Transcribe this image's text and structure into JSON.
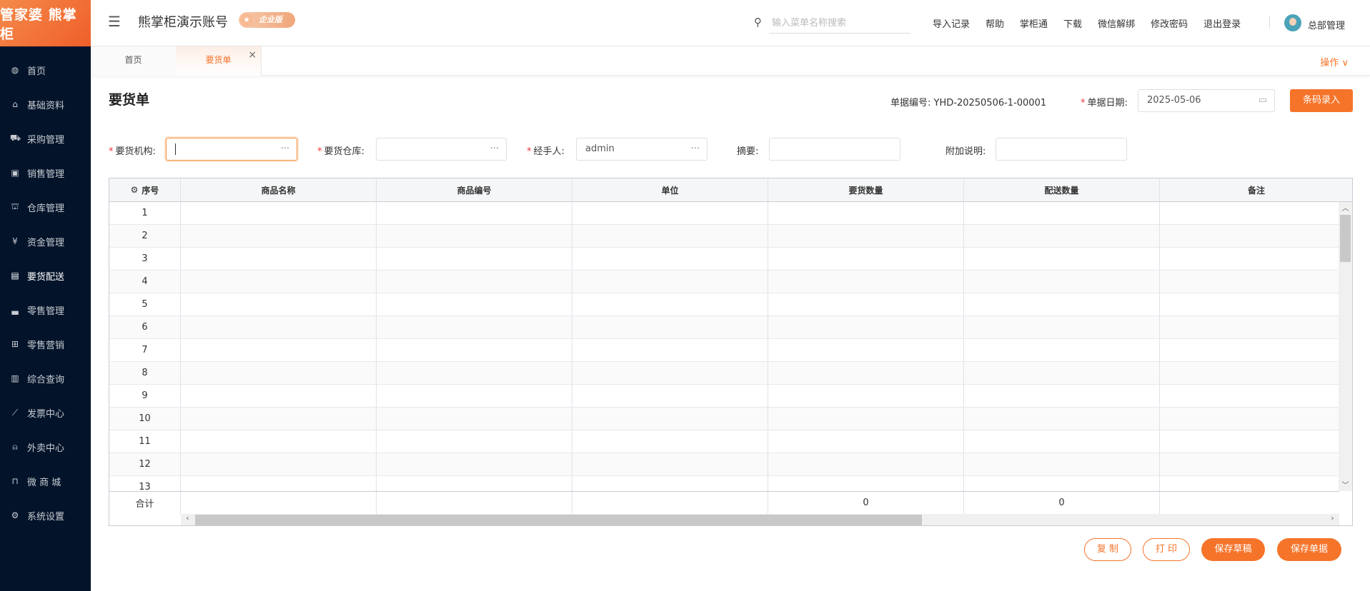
{
  "brand": {
    "logo_text": "管家婆 熊掌柜"
  },
  "sidebar": {
    "items": [
      {
        "label": "首页",
        "icon": "globe-icon",
        "glyph": "◍"
      },
      {
        "label": "基础资料",
        "icon": "home-icon",
        "glyph": "⌂"
      },
      {
        "label": "采购管理",
        "icon": "cart-icon",
        "glyph": "⛟"
      },
      {
        "label": "销售管理",
        "icon": "calendar-check-icon",
        "glyph": "▣"
      },
      {
        "label": "仓库管理",
        "icon": "bank-icon",
        "glyph": "⛫"
      },
      {
        "label": "资金管理",
        "icon": "yen-icon",
        "glyph": "¥"
      },
      {
        "label": "要货配送",
        "icon": "list-icon",
        "glyph": "▤",
        "active": true
      },
      {
        "label": "零售管理",
        "icon": "area-chart-icon",
        "glyph": "▃"
      },
      {
        "label": "零售营销",
        "icon": "gift-icon",
        "glyph": "⊞"
      },
      {
        "label": "综合查询",
        "icon": "bar-chart-icon",
        "glyph": "▥"
      },
      {
        "label": "发票中心",
        "icon": "line-chart-icon",
        "glyph": "⟋"
      },
      {
        "label": "外卖中心",
        "icon": "bell-icon",
        "glyph": "⍝"
      },
      {
        "label": "微 商 城",
        "icon": "bag-icon",
        "glyph": "⊓"
      },
      {
        "label": "系统设置",
        "icon": "gear-icon",
        "glyph": "⚙"
      }
    ]
  },
  "header": {
    "account": "熊掌柜演示账号",
    "edition": "企业版",
    "search_placeholder": "输入菜单名称搜索",
    "links": [
      "导入记录",
      "帮助",
      "掌柜通",
      "下载",
      "微信解绑",
      "修改密码",
      "退出登录"
    ],
    "user": "总部管理"
  },
  "tabs": {
    "items": [
      "首页",
      "要货单"
    ],
    "ops": "操作 ∨"
  },
  "form": {
    "title": "要货单",
    "doc_no_label": "单据编号:",
    "doc_no": "YHD-20250506-1-00001",
    "date_label": "单据日期:",
    "date": "2025-05-06",
    "barcode_btn": "条码录入",
    "org_label": "要货机构:",
    "org_value": "",
    "wh_label": "要货仓库:",
    "wh_value": "",
    "handler_label": "经手人:",
    "handler_value": "admin",
    "summary_label": "摘要:",
    "summary_value": "",
    "note_label": "附加说明:",
    "note_value": ""
  },
  "table": {
    "columns": [
      "序号",
      "商品名称",
      "商品编号",
      "单位",
      "要货数量",
      "配送数量",
      "备注"
    ],
    "rows": [
      "1",
      "2",
      "3",
      "4",
      "5",
      "6",
      "7",
      "8",
      "9",
      "10",
      "11",
      "12",
      "13"
    ],
    "footer": {
      "label": "合计",
      "qty_total": "0",
      "delivery_total": "0"
    }
  },
  "actions": {
    "copy": "复 制",
    "print": "打 印",
    "save_draft": "保存草稿",
    "save": "保存单据"
  },
  "colors": {
    "accent": "#f5742a",
    "sidebar": "#03142a"
  }
}
